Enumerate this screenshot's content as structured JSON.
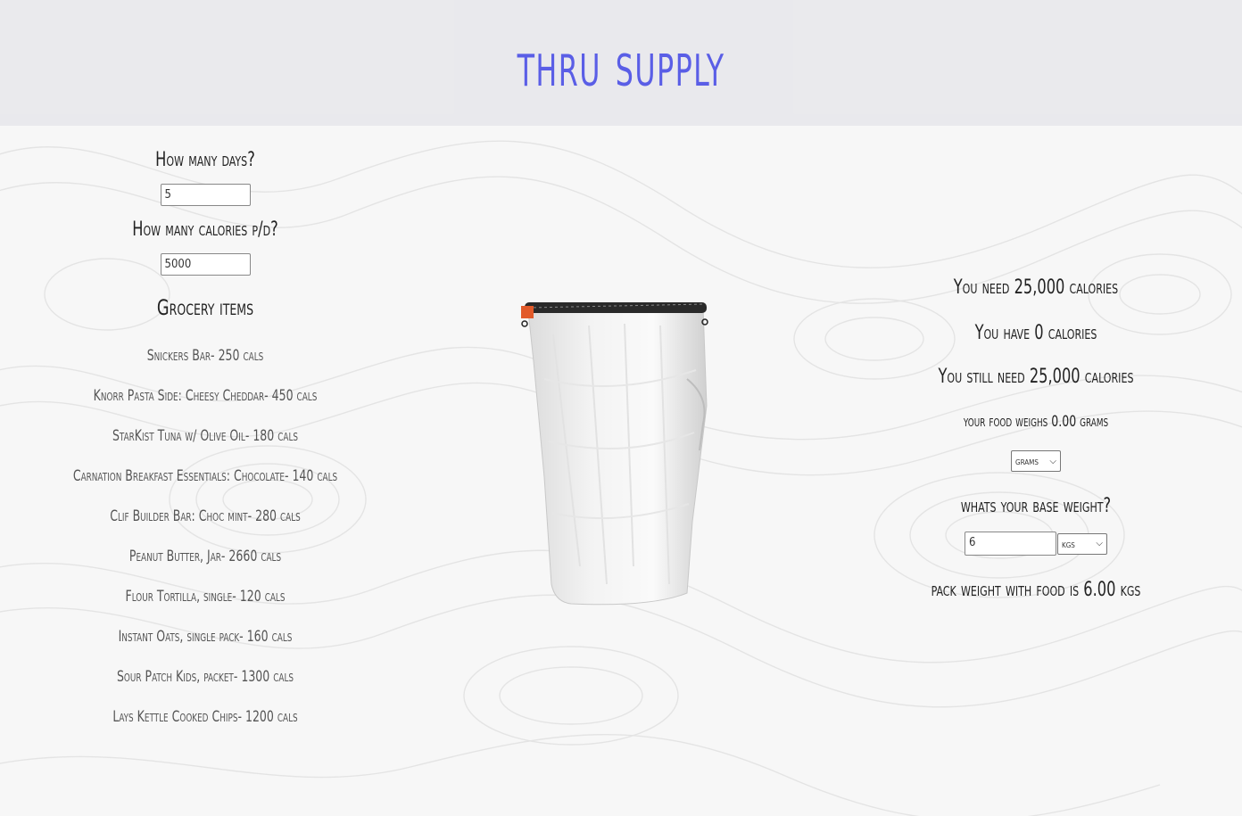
{
  "header": {
    "title": "thru supply"
  },
  "left": {
    "days_label": "How many days?",
    "days_value": "5",
    "calories_label": "How many calories p/d?",
    "calories_value": "5000",
    "grocery_title": "Grocery items",
    "grocery_items": [
      "Snickers Bar- 250 cals",
      "Knorr Pasta Side: Cheesy Cheddar- 450 cals",
      "StarKist Tuna w/ Olive Oil- 180 cals",
      "Carnation Breakfast Essentials: Chocolate- 140 cals",
      "Clif Builder Bar: Choc mint- 280 cals",
      "Peanut Butter, Jar- 2660 cals",
      "Flour Tortilla, single- 120 cals",
      "Instant Oats, single pack- 160 cals",
      "Sour Patch Kids, packet- 1300 cals",
      "Lays Kettle Cooked Chips- 1200 cals"
    ]
  },
  "right": {
    "need_text": "You need 25,000 calories",
    "have_text": "You have 0 calories",
    "still_need_text": "You still need 25,000 calories",
    "food_weight_text": "your food weighs 0.00 grams",
    "unit_select_value": "grams",
    "base_weight_label": "whats your base weight?",
    "base_weight_value": "6",
    "base_unit_value": "kgs",
    "pack_weight_text": "pack weight with food is 6.00 kgs"
  },
  "icons": {
    "select_chevron": "chevron-down-icon",
    "food_bag": "food-bag-image"
  },
  "colors": {
    "title": "#5a5ee6",
    "background": "#f7f7f7",
    "header_band": "#e6e6ea"
  }
}
